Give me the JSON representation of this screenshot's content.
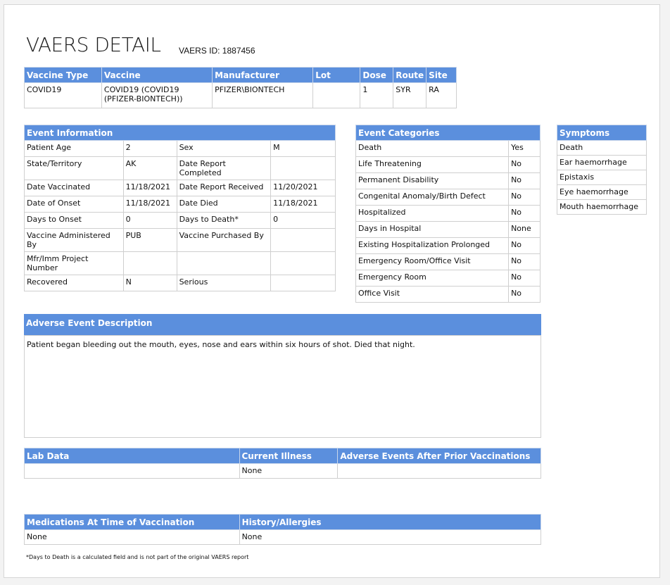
{
  "title": "VAERS DETAIL",
  "vaers_id_label": "VAERS ID: 1887456",
  "vaccine": {
    "headers": [
      "Vaccine Type",
      "Vaccine",
      "Manufacturer",
      "Lot",
      "Dose",
      "Route",
      "Site"
    ],
    "type": "COVID19",
    "name": "COVID19 (COVID19 (PFIZER-BIONTECH))",
    "manufacturer": "PFIZER\\BIONTECH",
    "lot": "",
    "dose": "1",
    "route": "SYR",
    "site": "RA"
  },
  "event_info": {
    "header": "Event Information",
    "rows": [
      {
        "l1": "Patient Age",
        "v1": "2",
        "l2": "Sex",
        "v2": "M"
      },
      {
        "l1": "State/Territory",
        "v1": "AK",
        "l2": "Date Report Completed",
        "v2": ""
      },
      {
        "l1": "Date Vaccinated",
        "v1": "11/18/2021",
        "l2": "Date Report Received",
        "v2": "11/20/2021"
      },
      {
        "l1": "Date of Onset",
        "v1": "11/18/2021",
        "l2": "Date Died",
        "v2": "11/18/2021"
      },
      {
        "l1": "Days to Onset",
        "v1": "0",
        "l2": "Days to Death*",
        "v2": "0"
      },
      {
        "l1": "Vaccine Administered By",
        "v1": "PUB",
        "l2": "Vaccine Purchased By",
        "v2": ""
      },
      {
        "l1": "Mfr/Imm Project Number",
        "v1": "",
        "l2": "",
        "v2": ""
      },
      {
        "l1": "Recovered",
        "v1": "N",
        "l2": "Serious",
        "v2": ""
      }
    ]
  },
  "event_categories": {
    "header": "Event Categories",
    "rows": [
      {
        "label": "Death",
        "value": "Yes"
      },
      {
        "label": "Life Threatening",
        "value": "No"
      },
      {
        "label": "Permanent Disability",
        "value": "No"
      },
      {
        "label": "Congenital Anomaly/Birth Defect",
        "value": "No"
      },
      {
        "label": "Hospitalized",
        "value": "No"
      },
      {
        "label": "Days in Hospital",
        "value": "None"
      },
      {
        "label": "Existing Hospitalization Prolonged",
        "value": "No"
      },
      {
        "label": "Emergency Room/Office Visit",
        "value": "No"
      },
      {
        "label": "Emergency Room",
        "value": "No"
      },
      {
        "label": "Office Visit",
        "value": "No"
      }
    ]
  },
  "symptoms": {
    "header": "Symptoms",
    "items": [
      "Death",
      "Ear haemorrhage",
      "Epistaxis",
      "Eye haemorrhage",
      "Mouth haemorrhage"
    ]
  },
  "adverse_event": {
    "header": "Adverse Event Description",
    "text": "Patient began bleeding out the mouth, eyes, nose and ears within six hours of shot. Died that night."
  },
  "lab": {
    "headers": [
      "Lab Data",
      "Current Illness",
      "Adverse Events After Prior Vaccinations"
    ],
    "values": [
      "",
      "None",
      ""
    ]
  },
  "meds": {
    "headers": [
      "Medications At Time of Vaccination",
      "History/Allergies"
    ],
    "values": [
      "None",
      "None"
    ]
  },
  "footnote": "*Days to Death is a calculated field and is not part of the original VAERS report"
}
